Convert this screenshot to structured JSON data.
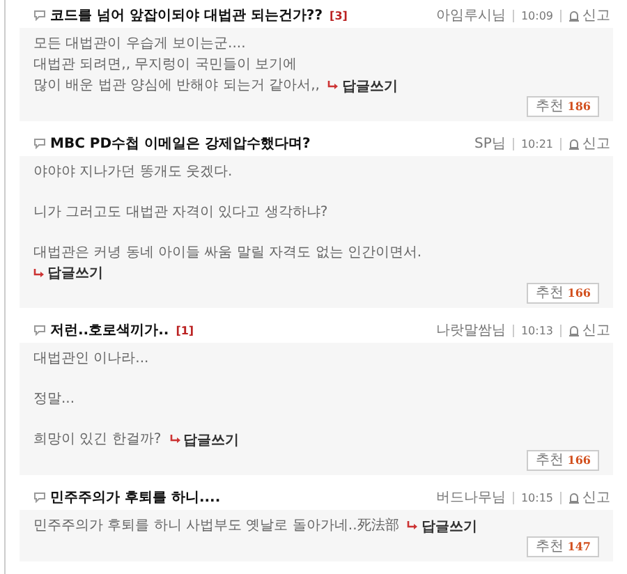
{
  "comments": [
    {
      "title": "코드를 넘어 앞잡이되야 대법관 되는건가??",
      "reply_count": "[3]",
      "author": "아임루시님",
      "time": "10:09",
      "report": "신고",
      "paragraphs": [
        [
          "모든 대법관이 우습게 보이는군....",
          "대법관 되려면,, 무지렁이 국민들이 보기에",
          "많이 배운 법관 양심에 반해야 되는거 같아서,,"
        ]
      ],
      "reply_link": "답글쓰기",
      "reply_on_new_line": false,
      "recommend": "추천",
      "votes": "186"
    },
    {
      "title": "MBC PD수첩 이메일은 강제압수했다며?",
      "author": "SP님",
      "time": "10:21",
      "report": "신고",
      "paragraphs": [
        [
          "야야야 지나가던 똥개도 웃겠다."
        ],
        [
          "니가 그러고도 대법관 자격이 있다고 생각하냐?"
        ],
        [
          "대법관은 커녕 동네 아이들 싸움 말릴 자격도 없는 인간이면서."
        ]
      ],
      "reply_link": "답글쓰기",
      "reply_on_new_line": true,
      "recommend": "추천",
      "votes": "166"
    },
    {
      "title": "저런..호로색끼가..",
      "reply_count": "[1]",
      "author": "나랏말쌈님",
      "time": "10:13",
      "report": "신고",
      "paragraphs": [
        [
          "대법관인 이나라..."
        ],
        [
          "정말..."
        ],
        [
          "희망이 있긴 한걸까?"
        ]
      ],
      "reply_link": "답글쓰기",
      "reply_on_new_line": false,
      "recommend": "추천",
      "votes": "166"
    },
    {
      "title": "민주주의가 후퇴를 하니....",
      "author": "버드나무님",
      "time": "10:15",
      "report": "신고",
      "paragraphs": [
        [
          "민주주의가 후퇴를 하니 사법부도 옛날로 돌아가네..死法部"
        ]
      ],
      "reply_link": "답글쓰기",
      "reply_on_new_line": false,
      "recommend": "추천",
      "votes": "147"
    }
  ]
}
